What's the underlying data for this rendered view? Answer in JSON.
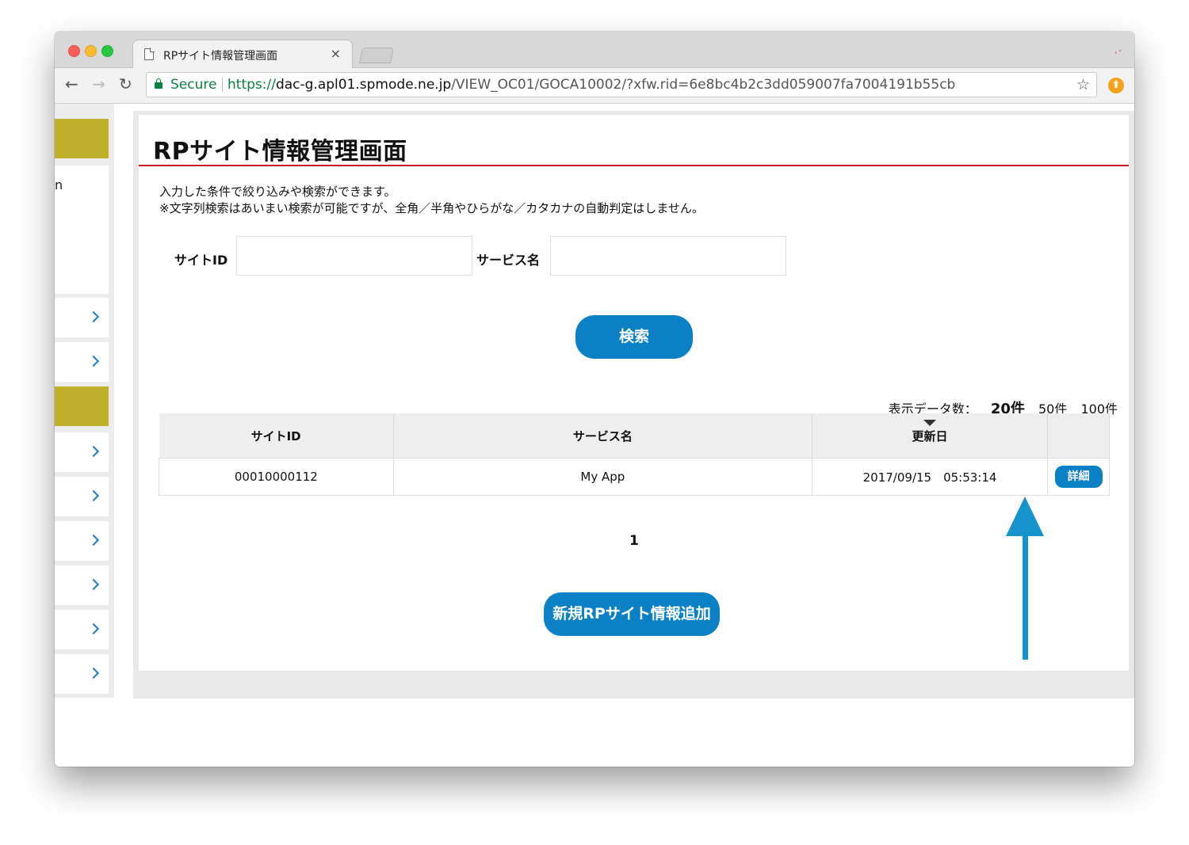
{
  "browser": {
    "tab_title": "RPサイト情報管理画面",
    "tab_close": "×",
    "extension_badge": "̹.",
    "security_label": "Secure",
    "url_scheme": "https://",
    "url_host": "dac-g.apl01.spmode.ne.jp",
    "url_path": "/VIEW_OC01/GOCA10002/?xfw.rid=6e8bc4b2c3dd059007fa7004191b55cb",
    "back_icon": "←",
    "forward_icon": "→",
    "reload_icon": "↻",
    "bookmark_icon": "☆"
  },
  "sidebar": {
    "partial_text": "n",
    "accent_color": "#bfb02a"
  },
  "page": {
    "title": "RPサイト情報管理画面",
    "description_line1": "入力した条件で絞り込みや検索ができます。",
    "description_line2": "※文字列検索はあいまい検索が可能ですが、全角／半角やひらがな／カタカナの自動判定はしません。"
  },
  "search": {
    "site_id_label": "サイトID",
    "site_id_value": "",
    "service_name_label": "サービス名",
    "service_name_value": "",
    "search_button": "検索"
  },
  "results": {
    "count_label": "表示データ数：",
    "count_options": [
      "20件",
      "50件",
      "100件"
    ],
    "selected_count": "20件",
    "columns": [
      "サイトID",
      "サービス名",
      "更新日",
      ""
    ],
    "rows": [
      {
        "site_id": "00010000112",
        "service_name": "My App",
        "updated": "2017/09/15　05:53:14",
        "action": "詳細"
      }
    ],
    "pagination_current": "1"
  },
  "actions": {
    "add_button": "新規RPサイト情報追加"
  },
  "colors": {
    "primary_button": "#0b80c5",
    "title_underline": "#c8141e",
    "annotation_arrow": "#1493cc"
  }
}
